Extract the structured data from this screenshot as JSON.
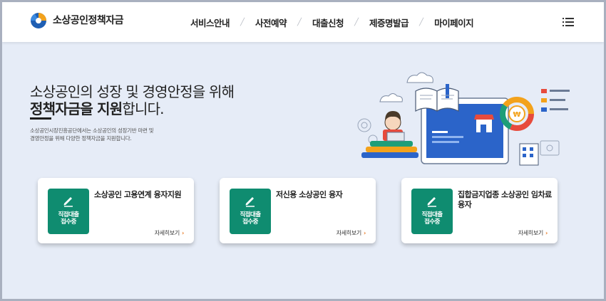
{
  "header": {
    "logo_text": "소상공인정책자금",
    "nav": [
      {
        "label": "서비스안내"
      },
      {
        "label": "사전예약"
      },
      {
        "label": "대출신청"
      },
      {
        "label": "제증명발급"
      },
      {
        "label": "마이페이지"
      }
    ],
    "menu_icon": "hamburger-menu-icon"
  },
  "hero": {
    "title_line1": "소상공인의 성장 및 경영안정을 위해",
    "title_line2_bold": "정책자금을 지원",
    "title_line2_rest": "합니다.",
    "description_line1": "소상공인시장진흥공단에서는 소상공인의 성장기반 마련 및",
    "description_line2": "경영안정을 위해 다양한 정책자금을 지원합니다."
  },
  "cards": [
    {
      "badge_line1": "직접대출",
      "badge_line2": "접수중",
      "title": "소상공인 고용연계 융자지원",
      "more": "자세히보기"
    },
    {
      "badge_line1": "직접대출",
      "badge_line2": "접수중",
      "title": "저신용 소상공인 융자",
      "more": "자세히보기"
    },
    {
      "badge_line1": "직접대출",
      "badge_line2": "접수중",
      "title": "집합금지업종 소상공인 임차료융자",
      "more": "자세히보기"
    }
  ],
  "colors": {
    "accent_green": "#0f8c70",
    "arrow_orange": "#e8731a",
    "page_bg": "#e6ecf7",
    "header_bg": "#ffffff"
  }
}
